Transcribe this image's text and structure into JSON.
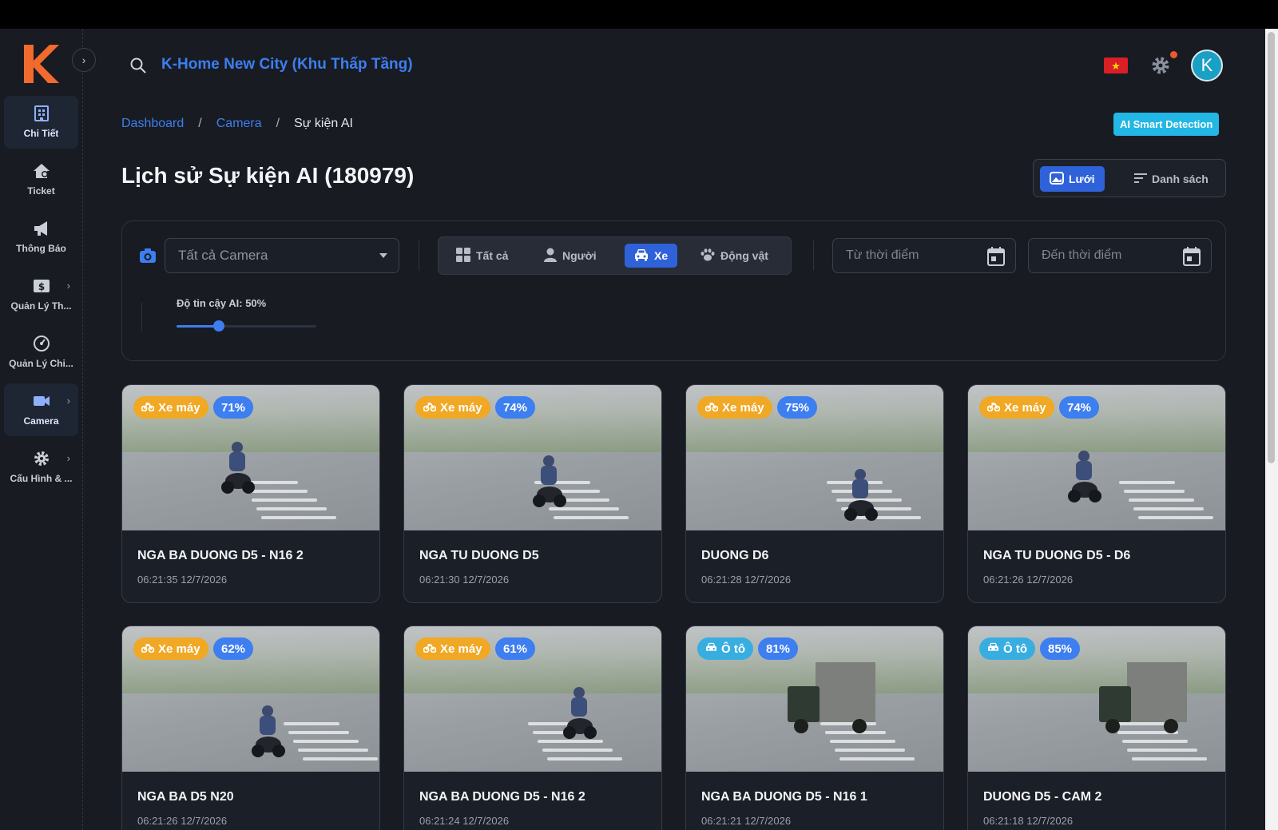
{
  "app": {
    "logo_letter": "K",
    "site_title": "K-Home New City (Khu Thấp Tầng)",
    "avatar_letter": "K",
    "flag_star": "★"
  },
  "sidebar": {
    "items": [
      {
        "label": "Chi Tiết",
        "icon": "building-icon",
        "active": true,
        "has_arrow": false
      },
      {
        "label": "Ticket",
        "icon": "house-icon",
        "active": false,
        "has_arrow": false
      },
      {
        "label": "Thông Báo",
        "icon": "megaphone-icon",
        "active": false,
        "has_arrow": false
      },
      {
        "label": "Quản Lý Th...",
        "icon": "dollar-icon",
        "active": false,
        "has_arrow": true
      },
      {
        "label": "Quản Lý Chi...",
        "icon": "gauge-icon",
        "active": false,
        "has_arrow": false
      },
      {
        "label": "Camera",
        "icon": "video-camera-icon",
        "active": true,
        "has_arrow": true
      },
      {
        "label": "Cấu Hình & ...",
        "icon": "gear-icon",
        "active": false,
        "has_arrow": true
      }
    ]
  },
  "breadcrumb": {
    "items": [
      "Dashboard",
      "Camera"
    ],
    "separator": "/",
    "current": "Sự kiện AI"
  },
  "badge": "AI Smart Detection",
  "page_title": "Lịch sử Sự kiện AI (180979)",
  "view_toggle": {
    "grid": "Lưới",
    "list": "Danh sách",
    "active": "grid"
  },
  "filters": {
    "camera_placeholder": "Tất cả Camera",
    "types": [
      {
        "label": "Tất cả",
        "icon": "grid-icon",
        "active": false
      },
      {
        "label": "Người",
        "icon": "person-icon",
        "active": false
      },
      {
        "label": "Xe",
        "icon": "car-icon",
        "active": true
      },
      {
        "label": "Động vật",
        "icon": "paw-icon",
        "active": false
      }
    ],
    "from_placeholder": "Từ thời điểm",
    "to_placeholder": "Đến thời điểm",
    "confidence_label": "Độ tin cậy AI: 50%",
    "confidence_value": 0.5
  },
  "colors": {
    "accent": "#2f62d9",
    "link": "#3d7ef0",
    "motorbike_chip": "#f0a825",
    "car_chip": "#38aee0",
    "badge": "#22b7e5"
  },
  "events": [
    {
      "type": "Xe máy",
      "kind": "motorbike",
      "confidence": "71%",
      "camera": "NGA BA DUONG D5 - N16 2",
      "time": "06:21:35 12/7/2026"
    },
    {
      "type": "Xe máy",
      "kind": "motorbike",
      "confidence": "74%",
      "camera": "NGA TU DUONG D5",
      "time": "06:21:30 12/7/2026"
    },
    {
      "type": "Xe máy",
      "kind": "motorbike",
      "confidence": "75%",
      "camera": "DUONG D6",
      "time": "06:21:28 12/7/2026"
    },
    {
      "type": "Xe máy",
      "kind": "motorbike",
      "confidence": "74%",
      "camera": "NGA TU DUONG D5 - D6",
      "time": "06:21:26 12/7/2026"
    },
    {
      "type": "Xe máy",
      "kind": "motorbike",
      "confidence": "62%",
      "camera": "NGA BA D5 N20",
      "time": "06:21:26 12/7/2026"
    },
    {
      "type": "Xe máy",
      "kind": "motorbike",
      "confidence": "61%",
      "camera": "NGA BA DUONG D5 - N16 2",
      "time": "06:21:24 12/7/2026"
    },
    {
      "type": "Ô tô",
      "kind": "car",
      "confidence": "81%",
      "camera": "NGA BA DUONG D5 - N16 1",
      "time": "06:21:21 12/7/2026"
    },
    {
      "type": "Ô tô",
      "kind": "car",
      "confidence": "85%",
      "camera": "DUONG D5 - CAM 2",
      "time": "06:21:18 12/7/2026"
    }
  ]
}
